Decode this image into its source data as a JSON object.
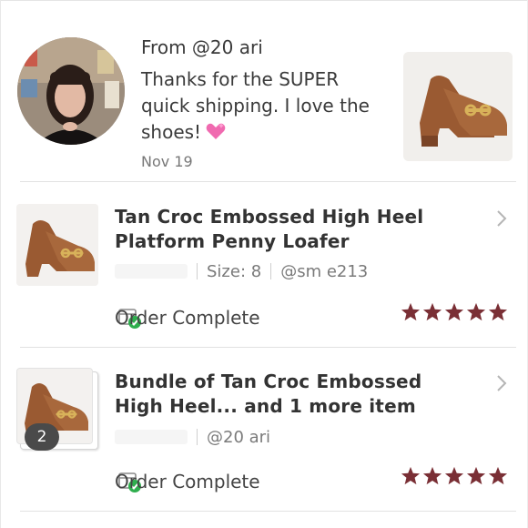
{
  "review": {
    "from": "From @20‍   ari",
    "text": "Thanks for the SUPER quick shipping. I love the shoes!",
    "date": "Nov 19"
  },
  "orders": [
    {
      "title": "Tan Croc Embossed High Heel Platform Penny Loafer",
      "size": "Size: 8",
      "buyer": "@sm     e213",
      "status": "Order Complete",
      "rating": 5
    },
    {
      "title": "Bundle of Tan Croc Embossed High Heel... and 1 more item",
      "buyer": "@20     ari",
      "count": "2",
      "status": "Order Complete",
      "rating": 5
    }
  ],
  "colors": {
    "star": "#7a2f35",
    "check": "#2fae4e",
    "shoe": "#9a5a32",
    "buckle": "#d8b25a"
  },
  "icons": {
    "heart": "sparkling-heart",
    "chevron": "chevron-right",
    "status": "package-check",
    "star": "star"
  }
}
